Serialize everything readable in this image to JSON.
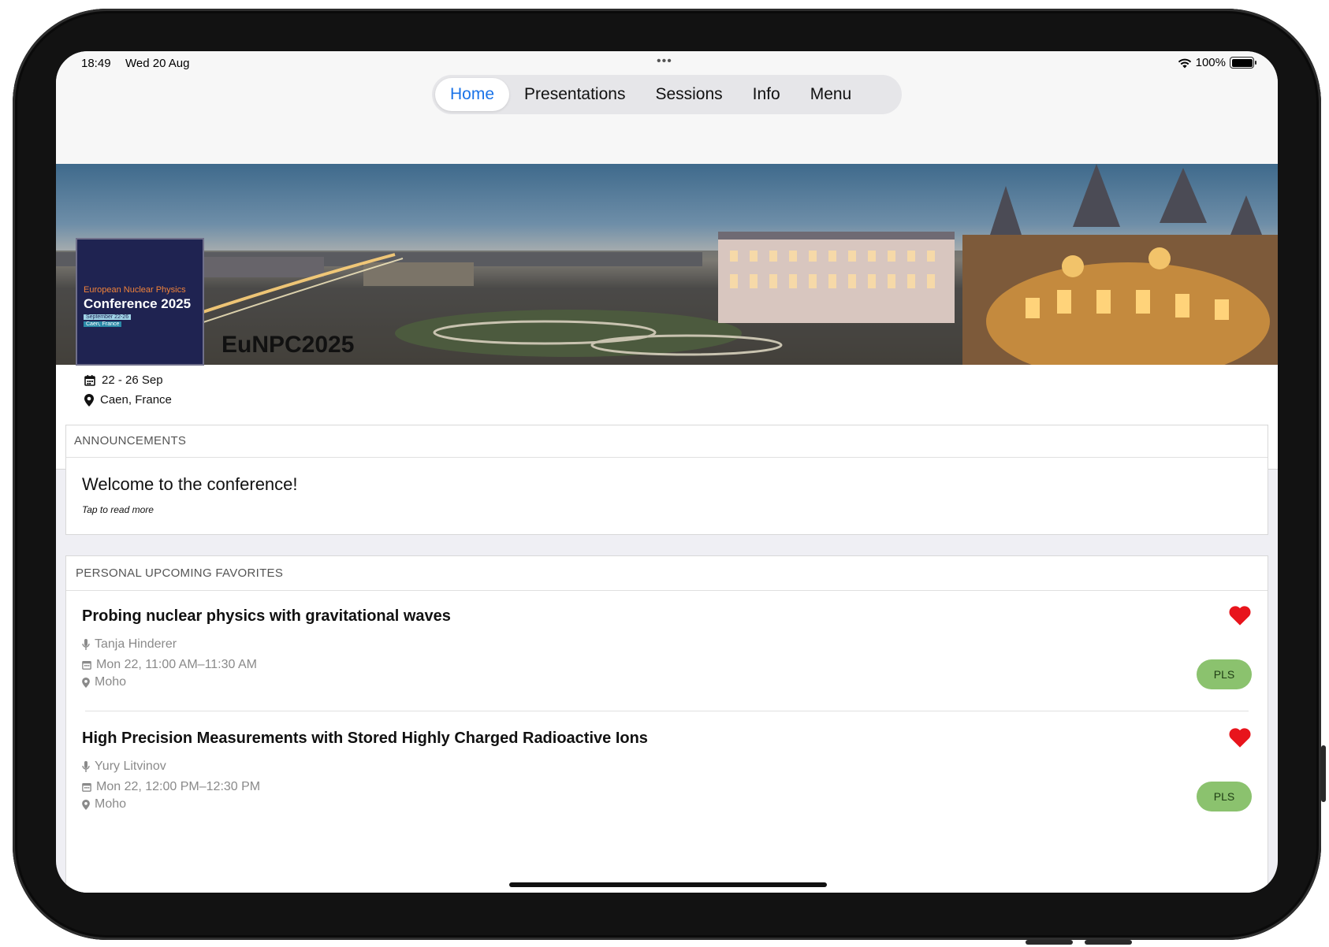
{
  "status_bar": {
    "time": "18:49",
    "date": "Wed 20 Aug",
    "battery": "100%"
  },
  "tabs": [
    {
      "label": "Home",
      "active": true
    },
    {
      "label": "Presentations",
      "active": false
    },
    {
      "label": "Sessions",
      "active": false
    },
    {
      "label": "Info",
      "active": false
    },
    {
      "label": "Menu",
      "active": false
    }
  ],
  "conference": {
    "name": "EuNPC2025",
    "dates": "22 - 26 Sep",
    "location": "Caen, France",
    "logo": {
      "line1": "European Nuclear Physics",
      "line2": "Conference 2025",
      "line3": "September 22-26",
      "line4": "Caen, France"
    }
  },
  "announcements": {
    "header": "ANNOUNCEMENTS",
    "title": "Welcome to the conference!",
    "subtitle": "Tap to read more"
  },
  "favorites": {
    "header": "PERSONAL UPCOMING FAVORITES",
    "items": [
      {
        "title": "Probing nuclear physics with gravitational waves",
        "speaker": "Tanja Hinderer",
        "time": "Mon 22, 11:00 AM–11:30 AM",
        "room": "Moho",
        "badge": "PLS"
      },
      {
        "title": "High Precision Measurements with Stored Highly Charged Radioactive Ions",
        "speaker": "Yury Litvinov",
        "time": "Mon 22, 12:00 PM–12:30 PM",
        "room": "Moho",
        "badge": "PLS"
      }
    ]
  },
  "colors": {
    "accent": "#1a73e8",
    "heart": "#e8141c",
    "badge": "#8bc26e",
    "logo_bg": "#1f2351"
  },
  "icons": [
    "wifi-icon",
    "battery-icon",
    "calendar-icon",
    "location-pin-icon",
    "microphone-icon",
    "heart-icon"
  ]
}
